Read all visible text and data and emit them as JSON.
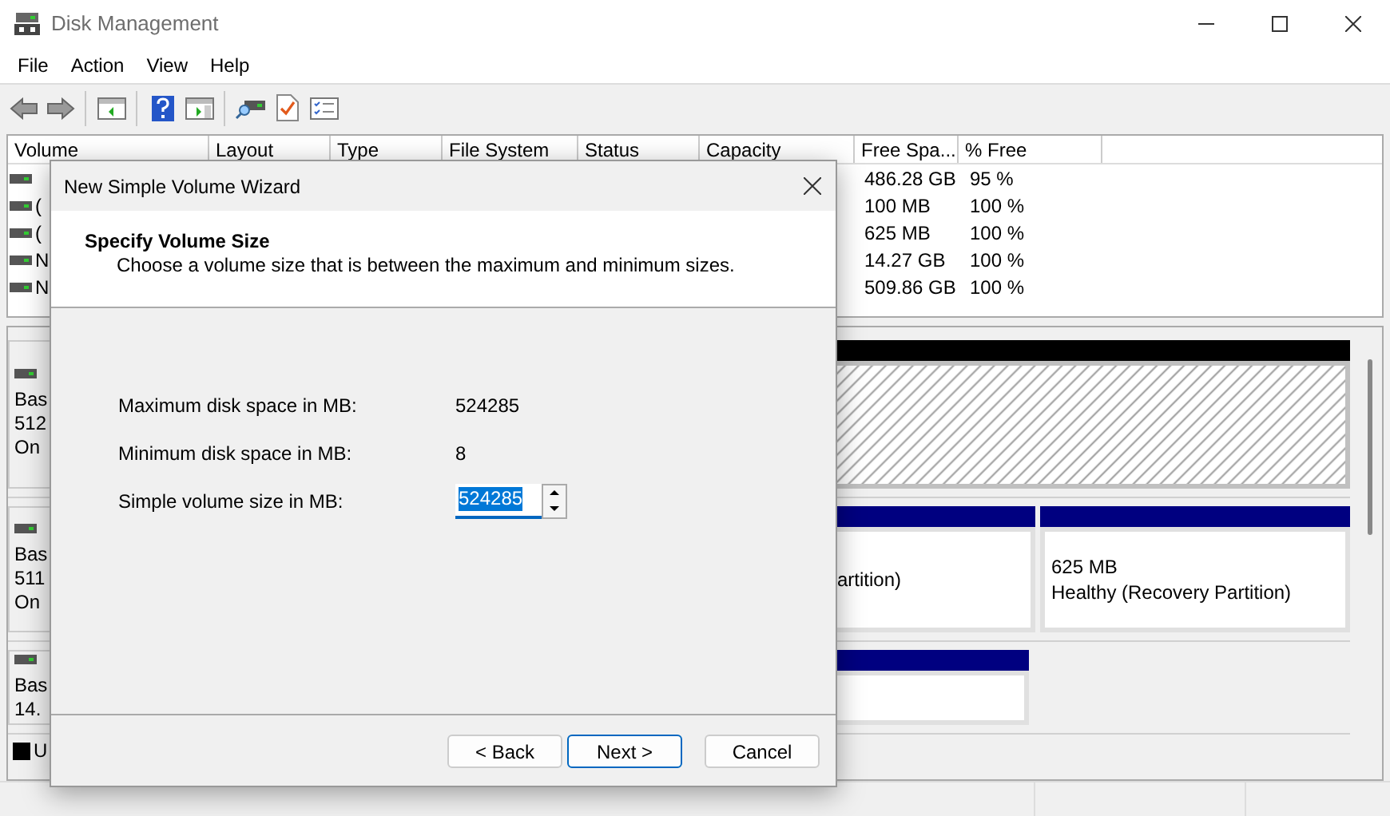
{
  "window": {
    "title": "Disk Management"
  },
  "menu": [
    "File",
    "Action",
    "View",
    "Help"
  ],
  "volume_list": {
    "columns": [
      "Volume",
      "Layout",
      "Type",
      "File System",
      "Status",
      "Capacity",
      "Free Spa...",
      "% Free"
    ],
    "rows": [
      {
        "free_space": "486.28 GB",
        "percent_free": "95 %"
      },
      {
        "volume": "(",
        "free_space": "100 MB",
        "percent_free": "100 %"
      },
      {
        "volume": "(",
        "free_space": "625 MB",
        "percent_free": "100 %"
      },
      {
        "volume": "N",
        "free_space": "14.27 GB",
        "percent_free": "100 %"
      },
      {
        "volume": "N",
        "free_space": "509.86 GB",
        "percent_free": "100 %"
      }
    ]
  },
  "disks": [
    {
      "label_lines": [
        "Bas",
        "512",
        "On"
      ],
      "partitions": [
        {
          "kind": "unallocated"
        }
      ]
    },
    {
      "label_lines": [
        "Bas",
        "511",
        "On"
      ],
      "partitions": [
        {
          "kind": "primary",
          "lines": [
            "artition)"
          ]
        },
        {
          "kind": "primary",
          "lines": [
            "625 MB",
            "Healthy (Recovery Partition)"
          ]
        }
      ]
    },
    {
      "label_lines": [
        "Bas",
        "14."
      ],
      "partitions": [
        {
          "kind": "primary"
        }
      ]
    }
  ],
  "legend": [
    {
      "label": "U",
      "color": "#000000"
    }
  ],
  "dialog": {
    "title": "New Simple Volume Wizard",
    "heading": "Specify Volume Size",
    "subtitle": "Choose a volume size that is between the maximum and minimum sizes.",
    "fields": [
      {
        "kind": "readout",
        "label": "Maximum disk space in MB:",
        "value": "524285"
      },
      {
        "kind": "readout",
        "label": "Minimum disk space in MB:",
        "value": "8"
      },
      {
        "kind": "spinner",
        "label": "Simple volume size in MB:",
        "value": "524285",
        "text_selected": true
      }
    ],
    "buttons": [
      {
        "label": "< Back",
        "default": false
      },
      {
        "label": "Next >",
        "default": true
      },
      {
        "label": "Cancel",
        "default": false
      }
    ]
  }
}
